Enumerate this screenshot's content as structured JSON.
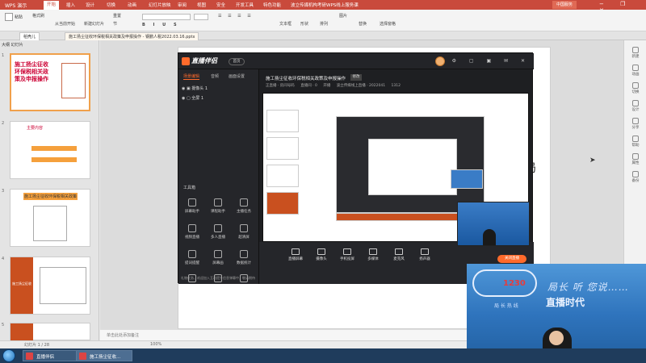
{
  "wps": {
    "app_name": "WPS 演示",
    "menu": [
      "开始",
      "插入",
      "设计",
      "切换",
      "动画",
      "幻灯片放映",
      "审阅",
      "视图",
      "安全",
      "开发工具",
      "特色功能",
      "波立传媒机构考研WPS线上服务课"
    ],
    "active_menu": "开始",
    "user_button": "中国服务",
    "window_controls": "− ❐ ✕",
    "ribbon": {
      "paste": "粘贴",
      "format_painter": "格式刷",
      "from_current": "从当前开始",
      "new_slide": "新建幻灯片",
      "reset": "重置",
      "section": "节",
      "shape": "形状",
      "arrange": "排列",
      "textbox": "文本框",
      "picture": "图片",
      "replace": "替换",
      "select_pane": "选择窗格"
    },
    "doc_tabs": [
      "稻壳儿",
      "施工扬尘征收环保税相关政策及申报操作 - 钢鹏人税2022.03.16.pptx"
    ],
    "left_panel_header": "大纲  幻灯片",
    "notes_placeholder": "单击此处添加备注",
    "status_left": "幻灯片 1 / 28",
    "status_right": "100%",
    "slide_text": "局",
    "thumbnails": [
      {
        "num": "1",
        "title": "施工扬尘征收环保税相关政策及申报操作"
      },
      {
        "num": "2",
        "title": "主要内容"
      },
      {
        "num": "3",
        "title": "施工扬尘征收环保税相关政策"
      },
      {
        "num": "4",
        "title": "施工扬尘征收"
      },
      {
        "num": "5",
        "title": ""
      }
    ],
    "right_sidebar": [
      "新建",
      "动画",
      "切换",
      "设计",
      "分享",
      "帮助",
      "属性",
      "备份"
    ]
  },
  "stream": {
    "logo": "直播伴侣",
    "home_button": "首页",
    "tabs": [
      "场景编辑",
      "音频",
      "画面设置"
    ],
    "scenes": [
      "摄像头 1",
      "全屏 1"
    ],
    "toolbox_title": "工具箱",
    "tools": [
      "屏幕助手",
      "课程助手",
      "主播任务",
      "视频直播",
      "多人直播",
      "超清屏",
      "提词提醒",
      "屏幕画",
      "数据统计",
      "设置",
      "美颜",
      "更多"
    ],
    "title": "施工扬尘征收环保税相关政策及申报操作",
    "edit": "修改",
    "sub_info": [
      "正直播 · 房间号码",
      "直播间 · 0",
      "开播",
      "波立传媒线上直播 · 2022041",
      "1312"
    ],
    "bottom_buttons": [
      "直播屏幕",
      "摄像头",
      "手机投屏",
      "多媒体",
      "麦克风",
      "扬声器"
    ],
    "go_live": "关闭直播",
    "footnote": "礼物任务、欢迎加入互动提升信息弹幕中，敬请期待"
  },
  "taskbar": {
    "tasks": [
      "直播伴侣",
      "施工扬尘征收..."
    ]
  },
  "webcam": {
    "slogan1": "局长 听 您说……",
    "slogan2": "直播时代",
    "slogan3": "局 长 热 线",
    "badge": "1230"
  }
}
